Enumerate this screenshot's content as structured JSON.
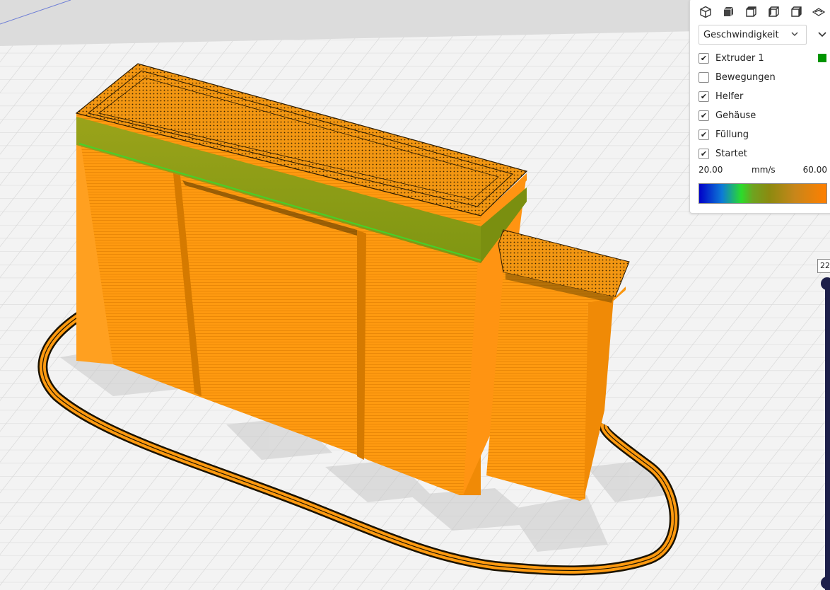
{
  "viewport": {
    "model_color": "#ff9a10",
    "band_color": "#8c9a12",
    "plate_color": "#f2f2f2"
  },
  "panel": {
    "view_buttons": [
      {
        "name": "3d-view-icon"
      },
      {
        "name": "front-view-icon"
      },
      {
        "name": "top-view-icon"
      },
      {
        "name": "left-view-icon"
      },
      {
        "name": "right-view-icon"
      },
      {
        "name": "x-ray-view-icon"
      }
    ],
    "color_scheme": {
      "selected": "Geschwindigkeit"
    },
    "items": [
      {
        "label": "Extruder 1",
        "checked": true
      },
      {
        "label": "Bewegungen",
        "checked": false
      },
      {
        "label": "Helfer",
        "checked": true
      },
      {
        "label": "Gehäuse",
        "checked": true
      },
      {
        "label": "Füllung",
        "checked": true
      },
      {
        "label": "Startet",
        "checked": true
      }
    ],
    "extruder_color": "#009400",
    "legend": {
      "min": "20.00",
      "unit": "mm/s",
      "max": "60.00"
    }
  },
  "layer_slider": {
    "value": "22"
  }
}
